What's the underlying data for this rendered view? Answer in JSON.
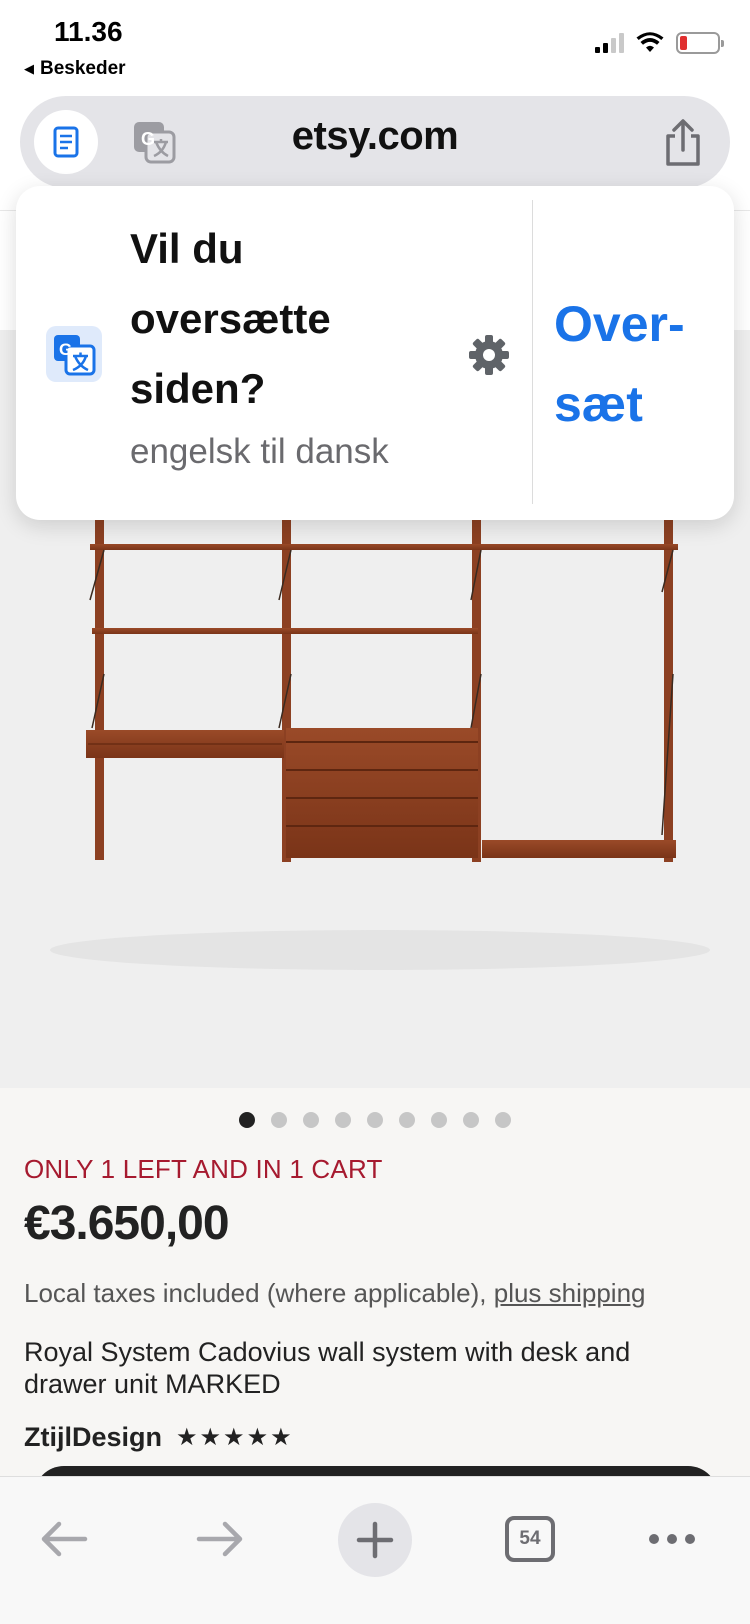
{
  "status_bar": {
    "time": "11.36",
    "back_app": "Beskeder"
  },
  "browser": {
    "url": "etsy.com",
    "tab_count": "54"
  },
  "translate_prompt": {
    "title": "Vil du oversætte siden?",
    "languages": "engelsk til dansk",
    "action_line1": "Over-",
    "action_line2": "sæt",
    "accent_color": "#1a73e8"
  },
  "listing": {
    "image_count": 9,
    "current_image": 1,
    "stock_notice": "ONLY 1 LEFT AND IN 1 CART",
    "price": "€3.650,00",
    "tax_text": "Local taxes included (where applicable),",
    "shipping_link": "plus shipping",
    "title": "Royal System Cadovius wall system with desk and drawer unit MARKED",
    "shop_name": "ZtijlDesign",
    "rating_stars": "★★★★★",
    "stock_color": "#a61a2f"
  }
}
